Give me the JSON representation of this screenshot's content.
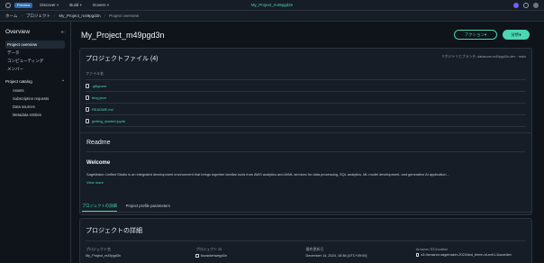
{
  "topbar": {
    "badge": "Preview",
    "nav": [
      "Discover",
      "Build",
      "Govern"
    ],
    "title": "My_Project_m49pgd3n"
  },
  "breadcrumb": {
    "items": [
      "ホーム",
      "プロジェクト",
      "My_Project_m49pgd3n",
      "Project overview"
    ]
  },
  "sidebar": {
    "title": "Overview",
    "items": [
      "Project overview",
      "データ",
      "コンピューティング",
      "メンバー"
    ],
    "section": "Project catalog",
    "sub_items": [
      "Assets",
      "Subscription requests",
      "Data sources",
      "Metadata entities"
    ]
  },
  "page": {
    "title": "My_Project_m49pgd3n",
    "actions_label": "アクション",
    "main_button": "分析"
  },
  "files": {
    "title": "プロジェクトファイル (4)",
    "repo_link": "リポジトリとブランチ: datazone-m49pgd3n-dev · main",
    "column": "ファイル名",
    "items": [
      ".gitignore",
      "blog.json",
      "README.md",
      "getting_started.ipynb"
    ]
  },
  "readme": {
    "title": "Readme",
    "heading": "Welcome",
    "body": "SageMaker Unified Studio is an integrated development environment that brings together familiar tools from AWS analytics and AI/ML services for data processing, SQL analytics, ML model development, and generative AI application...",
    "more": "View more"
  },
  "tabs": [
    "プロジェクトの詳細",
    "Project profile parameters"
  ],
  "details": {
    "title": "プロジェクトの詳細",
    "fields": [
      {
        "label": "プロジェクト名",
        "value": "My_Project_m49pgd3n"
      },
      {
        "label": "プロジェクト ID",
        "value": "6ozardehwegd3n"
      },
      {
        "label": "最終更新日",
        "value": "December 14, 2024, 16:38 (UTC+09:00)"
      },
      {
        "label": "Amazon S3 location",
        "value": "s3://amazon-sagemaker-2024/dzd_bhmn-id-ezh1-6ozar/dev"
      }
    ]
  }
}
